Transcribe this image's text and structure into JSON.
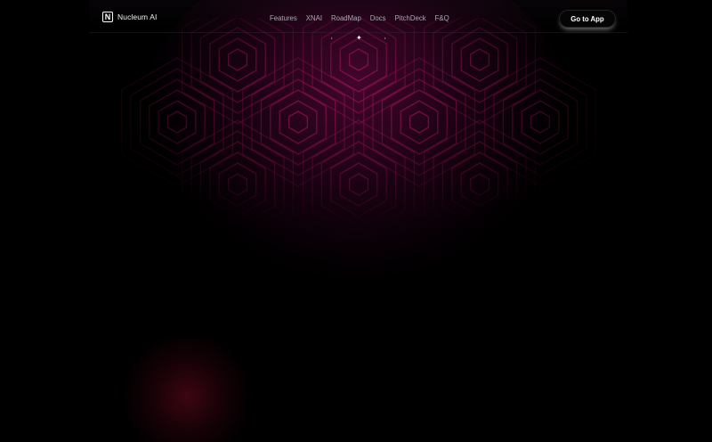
{
  "brand": {
    "logo_letter": "N",
    "name": "Nucleum AI"
  },
  "nav": {
    "items": [
      {
        "label": "Features"
      },
      {
        "label": "XNAI"
      },
      {
        "label": "RoadMap"
      },
      {
        "label": "Docs"
      },
      {
        "label": "PitchDeck"
      },
      {
        "label": "F&Q"
      }
    ]
  },
  "cta": {
    "label": "Go to App"
  },
  "decor": {
    "hex_pattern": "hexagon-grid-pattern",
    "sparkle_icon": "sparkle-icon",
    "accent_color": "#b0145f",
    "glow_color": "#6e0a3c"
  }
}
